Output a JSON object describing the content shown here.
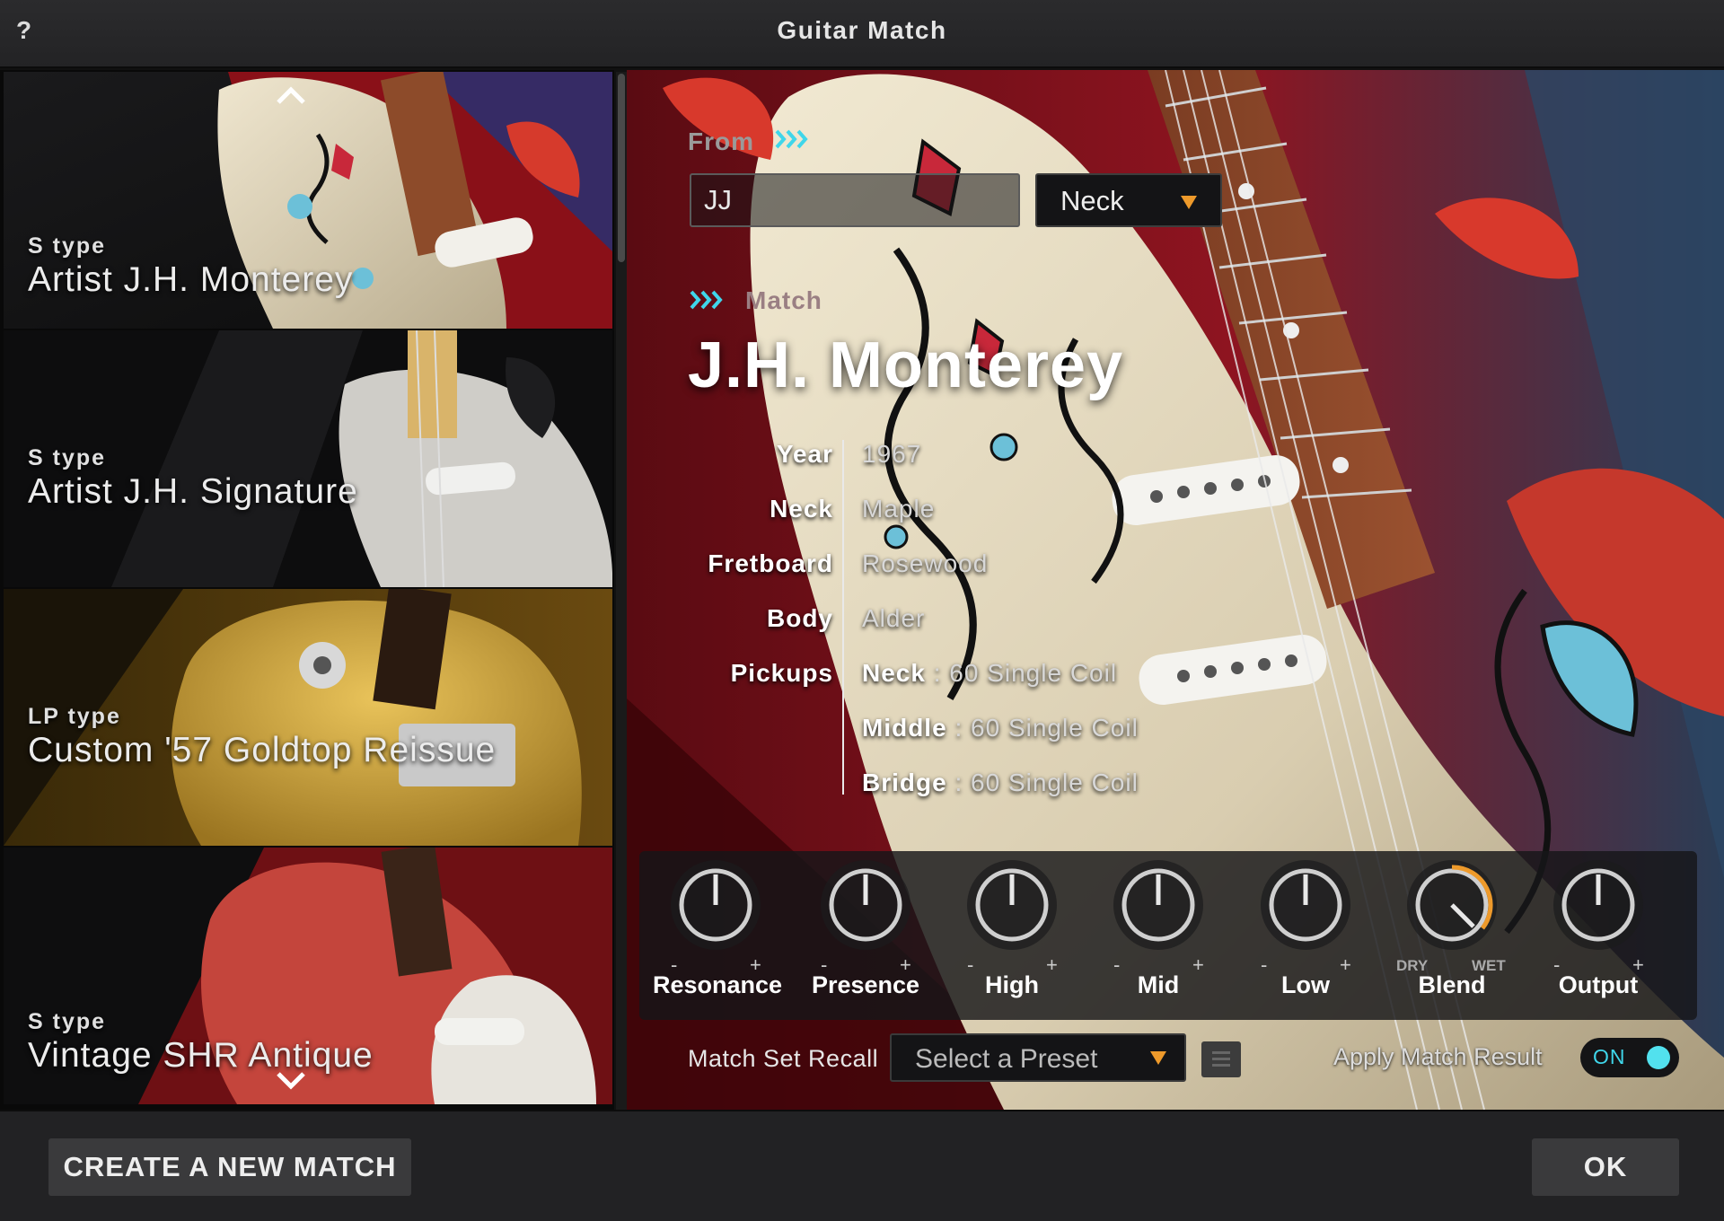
{
  "window": {
    "title": "Guitar Match",
    "help_label": "?"
  },
  "list": {
    "items": [
      {
        "type": "S type",
        "name": "Artist J.H. Monterey",
        "selected": true
      },
      {
        "type": "S type",
        "name": "Artist J.H. Signature",
        "selected": false
      },
      {
        "type": "LP type",
        "name": "Custom '57 Goldtop Reissue",
        "selected": false
      },
      {
        "type": "S type",
        "name": "Vintage SHR Antique",
        "selected": false
      }
    ],
    "up_icon": "chevron-up-icon",
    "down_icon": "chevron-down-icon"
  },
  "from": {
    "label": "From",
    "input_value": "JJ",
    "position_value": "Neck"
  },
  "match": {
    "label": "Match",
    "model": "J.H. Monterey"
  },
  "specs": {
    "year_label": "Year",
    "year": "1967",
    "neck_label": "Neck",
    "neck": "Maple",
    "fretboard_label": "Fretboard",
    "fretboard": "Rosewood",
    "body_label": "Body",
    "body": "Alder",
    "pickups_label": "Pickups",
    "pickups": [
      {
        "pos": "Neck",
        "sep": " : ",
        "desc": "60 Single Coil"
      },
      {
        "pos": "Middle",
        "sep": " : ",
        "desc": "60 Single Coil"
      },
      {
        "pos": "Bridge",
        "sep": " : ",
        "desc": "60 Single Coil"
      }
    ]
  },
  "knobs": [
    {
      "label": "Resonance",
      "min": "-",
      "max": "+",
      "value": 0.5
    },
    {
      "label": "Presence",
      "min": "-",
      "max": "+",
      "value": 0.5
    },
    {
      "label": "High",
      "min": "-",
      "max": "+",
      "value": 0.5
    },
    {
      "label": "Mid",
      "min": "-",
      "max": "+",
      "value": 0.5
    },
    {
      "label": "Low",
      "min": "-",
      "max": "+",
      "value": 0.5
    },
    {
      "label": "Blend",
      "min": "DRY",
      "max": "WET",
      "value": 0.85
    },
    {
      "label": "Output",
      "min": "-",
      "max": "+",
      "value": 0.5
    }
  ],
  "recall": {
    "label": "Match Set Recall",
    "preset_value": "Select a Preset"
  },
  "apply": {
    "label": "Apply Match Result",
    "toggle_label": "ON"
  },
  "buttons": {
    "create": "CREATE A NEW MATCH",
    "ok": "OK"
  },
  "colors": {
    "accent": "#3fd6ea",
    "selection": "#e9a530",
    "dropdown_arrow": "#ee9a2b"
  }
}
